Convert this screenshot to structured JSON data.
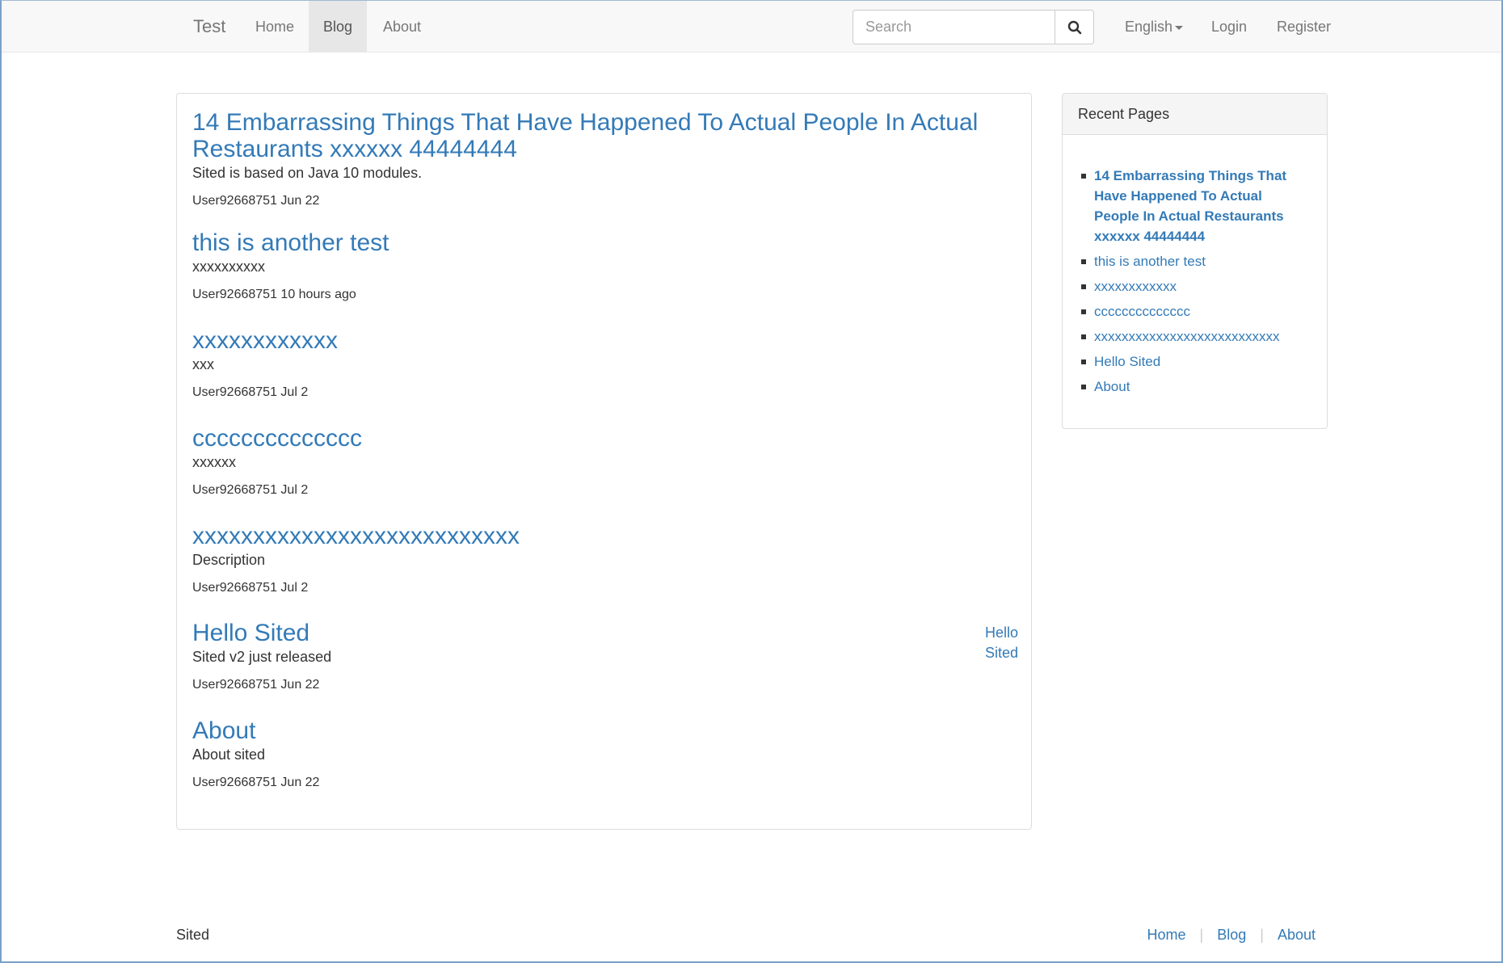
{
  "navbar": {
    "brand": "Test",
    "links": [
      "Home",
      "Blog",
      "About"
    ],
    "search_placeholder": "Search",
    "language": "English",
    "login": "Login",
    "register": "Register"
  },
  "posts": [
    {
      "title": "14 Embarrassing Things That Have Happened To Actual People In Actual Restaurants xxxxxx 44444444",
      "description": "Sited is based on Java 10 modules.",
      "meta": "User92668751 Jun 22"
    },
    {
      "title": "this is another test",
      "description": "xxxxxxxxxx",
      "meta": "User92668751 10 hours ago"
    },
    {
      "title": "xxxxxxxxxxxx",
      "description": "xxx",
      "meta": "User92668751 Jul 2"
    },
    {
      "title": "cccccccccccccc",
      "description": "xxxxxx",
      "meta": "User92668751 Jul 2"
    },
    {
      "title": "xxxxxxxxxxxxxxxxxxxxxxxxxxx",
      "description": "Description",
      "meta": "User92668751 Jul 2"
    },
    {
      "title": "Hello Sited",
      "description": "Sited v2 just released",
      "meta": "User92668751 Jun 22",
      "side_link": "Hello Sited"
    },
    {
      "title": "About",
      "description": "About sited",
      "meta": "User92668751 Jun 22"
    }
  ],
  "sidebar": {
    "heading": "Recent Pages",
    "items": [
      "14 Embarrassing Things That Have Happened To Actual People In Actual Restaurants xxxxxx 44444444",
      "this is another test",
      "xxxxxxxxxxxx",
      "cccccccccccccc",
      "xxxxxxxxxxxxxxxxxxxxxxxxxxx",
      "Hello Sited",
      "About"
    ]
  },
  "footer": {
    "brand": "Sited",
    "links": [
      "Home",
      "Blog",
      "About"
    ]
  },
  "colors": {
    "link": "#337ab7",
    "navbar_bg": "#f8f8f8",
    "active_nav_bg": "#e7e7e7"
  }
}
